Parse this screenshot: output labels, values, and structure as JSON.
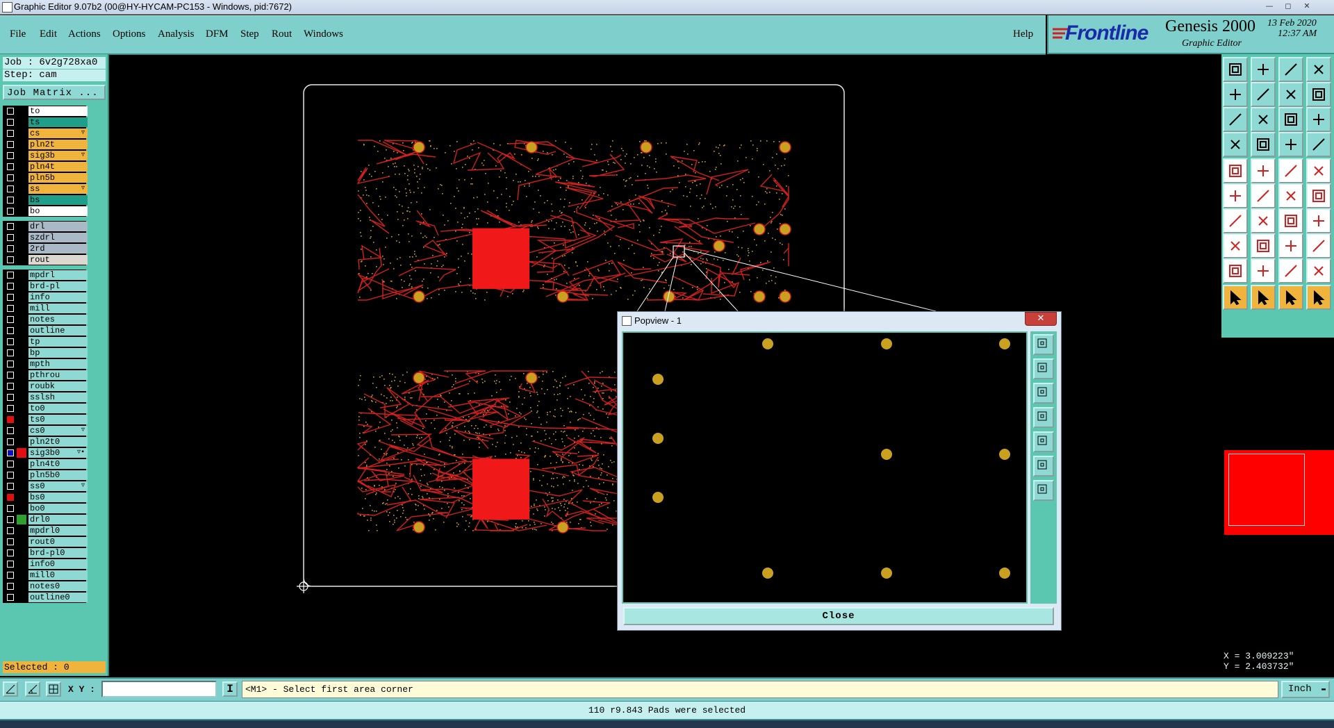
{
  "window": {
    "title": "Graphic Editor 9.07b2 (00@HY-HYCAM-PC153 - Windows, pid:7672)"
  },
  "menu": {
    "items": [
      "File",
      "Edit",
      "Actions",
      "Options",
      "Analysis",
      "DFM",
      "Step",
      "Rout",
      "Windows"
    ],
    "help": "Help"
  },
  "brand": {
    "company": "Frontline",
    "product": "Genesis 2000",
    "subtitle": "Graphic Editor",
    "date": "13 Feb 2020",
    "time": "12:37 AM"
  },
  "job": {
    "job_label": "Job : 6v2g728xa0",
    "step_label": "Step: cam",
    "matrix_button": "Job Matrix ..."
  },
  "layers": [
    {
      "name": "to",
      "bg": "#ffffff",
      "group": 1
    },
    {
      "name": "ts",
      "bg": "#1f9e8a",
      "group": 1
    },
    {
      "name": "cs",
      "bg": "#f0b43c",
      "group": 1,
      "mark": "▿"
    },
    {
      "name": "pln2t",
      "bg": "#f0b43c",
      "group": 1
    },
    {
      "name": "sig3b",
      "bg": "#f0b43c",
      "group": 1,
      "mark": "▿"
    },
    {
      "name": "pln4t",
      "bg": "#f0b43c",
      "group": 1
    },
    {
      "name": "pln5b",
      "bg": "#f0b43c",
      "group": 1
    },
    {
      "name": "ss",
      "bg": "#f0b43c",
      "group": 1,
      "mark": "▿"
    },
    {
      "name": "bs",
      "bg": "#1f9e8a",
      "group": 1
    },
    {
      "name": "bo",
      "bg": "#ffffff",
      "group": 1
    },
    {
      "name": "drl",
      "bg": "#a9b9c6",
      "group": 2
    },
    {
      "name": "szdrl",
      "bg": "#a9b9c6",
      "group": 2
    },
    {
      "name": "2rd",
      "bg": "#a9b9c6",
      "group": 2
    },
    {
      "name": "rout",
      "bg": "#dcd8cf",
      "group": 2
    },
    {
      "name": "mpdrl",
      "bg": "#8fd9d5",
      "group": 3
    },
    {
      "name": "brd-pl",
      "bg": "#8fd9d5",
      "group": 3
    },
    {
      "name": "info",
      "bg": "#8fd9d5",
      "group": 3
    },
    {
      "name": "mill",
      "bg": "#8fd9d5",
      "group": 3
    },
    {
      "name": "notes",
      "bg": "#8fd9d5",
      "group": 3
    },
    {
      "name": "outline",
      "bg": "#8fd9d5",
      "group": 3
    },
    {
      "name": "tp",
      "bg": "#8fd9d5",
      "group": 3
    },
    {
      "name": "bp",
      "bg": "#8fd9d5",
      "group": 3
    },
    {
      "name": "mpth",
      "bg": "#8fd9d5",
      "group": 3
    },
    {
      "name": "pthrou",
      "bg": "#8fd9d5",
      "group": 3
    },
    {
      "name": "roubk",
      "bg": "#8fd9d5",
      "group": 3
    },
    {
      "name": "sslsh",
      "bg": "#8fd9d5",
      "group": 3
    },
    {
      "name": "to0",
      "bg": "#8fd9d5",
      "group": 3
    },
    {
      "name": "ts0",
      "bg": "#8fd9d5",
      "group": 3,
      "cb": "red"
    },
    {
      "name": "cs0",
      "bg": "#8fd9d5",
      "group": 3,
      "mark": "▿"
    },
    {
      "name": "pln2t0",
      "bg": "#8fd9d5",
      "group": 3
    },
    {
      "name": "sig3b0",
      "bg": "#8fd9d5",
      "group": 3,
      "mark": "▿▪",
      "cb": "blue",
      "swatch": "#e01010"
    },
    {
      "name": "pln4t0",
      "bg": "#8fd9d5",
      "group": 3
    },
    {
      "name": "pln5b0",
      "bg": "#8fd9d5",
      "group": 3
    },
    {
      "name": "ss0",
      "bg": "#8fd9d5",
      "group": 3,
      "mark": "▿"
    },
    {
      "name": "bs0",
      "bg": "#8fd9d5",
      "group": 3,
      "cb": "red"
    },
    {
      "name": "bo0",
      "bg": "#8fd9d5",
      "group": 3
    },
    {
      "name": "drl0",
      "bg": "#8fd9d5",
      "group": 3,
      "swatch": "#2ea02e"
    },
    {
      "name": "mpdrl0",
      "bg": "#8fd9d5",
      "group": 3
    },
    {
      "name": "rout0",
      "bg": "#8fd9d5",
      "group": 3
    },
    {
      "name": "brd-pl0",
      "bg": "#8fd9d5",
      "group": 3
    },
    {
      "name": "info0",
      "bg": "#8fd9d5",
      "group": 3
    },
    {
      "name": "mill0",
      "bg": "#8fd9d5",
      "group": 3
    },
    {
      "name": "notes0",
      "bg": "#8fd9d5",
      "group": 3
    },
    {
      "name": "outline0",
      "bg": "#8fd9d5",
      "group": 3
    }
  ],
  "selected": "Selected : 0",
  "coords": {
    "x": "X = 3.009223\"",
    "y": "Y = 2.403732\""
  },
  "command": {
    "xy_label": "X Y :",
    "xy_value": "",
    "prompt": "<M1> - Select first area corner",
    "units": "Inch"
  },
  "status": "110 r9.843 Pads were selected",
  "popview": {
    "title": "Popview - 1",
    "close": "Close"
  },
  "colors": {
    "teal": "#7fd0cc",
    "panel": "#5cc7b0",
    "copper": "#d21f1f",
    "pad": "#c9a020"
  }
}
